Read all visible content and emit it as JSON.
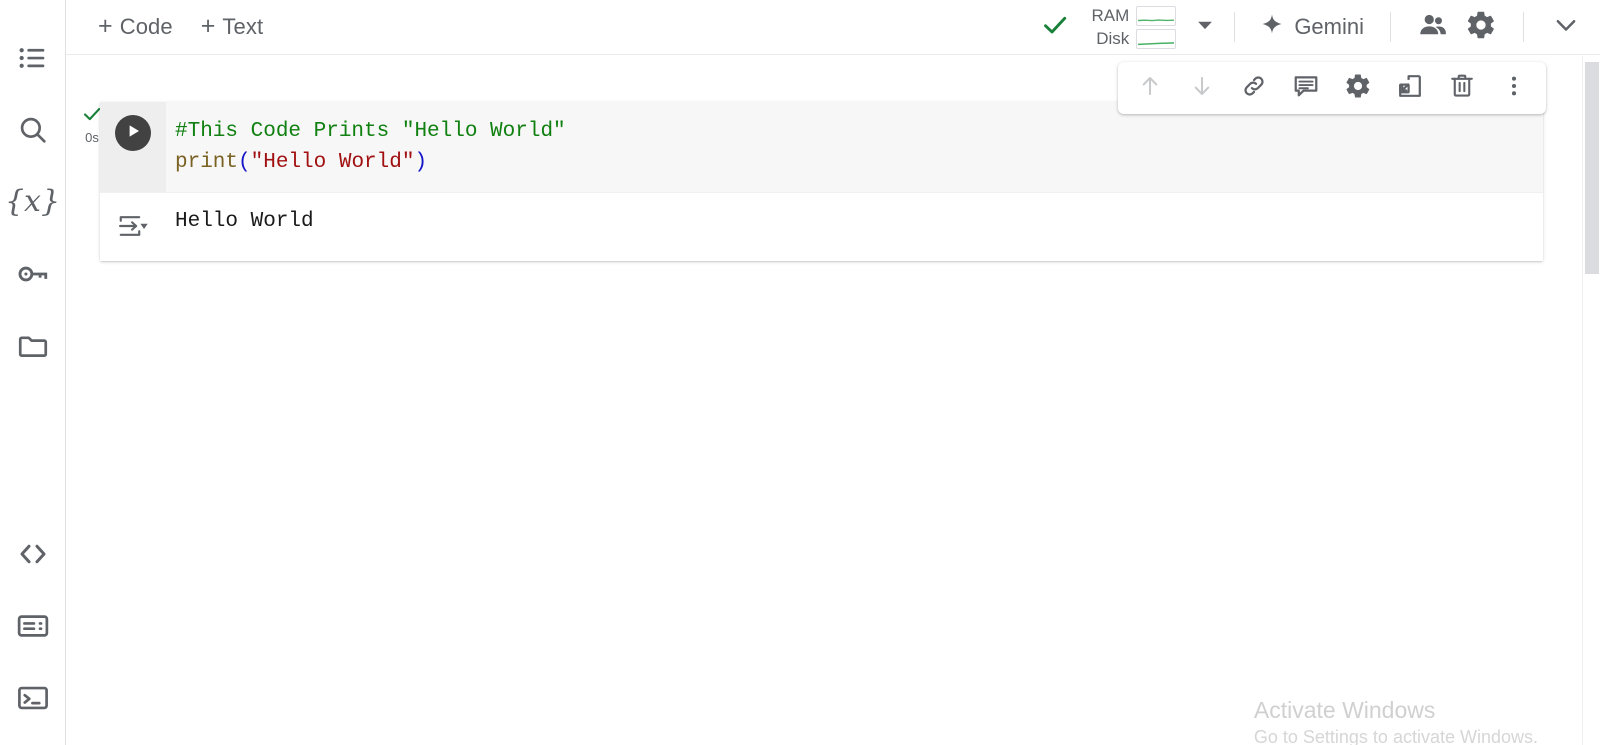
{
  "header": {
    "add_code_label": "Code",
    "add_text_label": "Text",
    "plus_symbol": "+",
    "connect_status_icon": "check-icon",
    "resources": [
      {
        "label": "RAM",
        "icon": "sparkline"
      },
      {
        "label": "Disk",
        "icon": "sparkline"
      }
    ],
    "resource_caret_icon": "caret-down-icon",
    "gemini_label": "Gemini",
    "gemini_icon": "sparkle-icon",
    "share_icon": "people-icon",
    "settings_icon": "gear-icon",
    "collapse_icon": "chevron-down-icon"
  },
  "sidebar": {
    "top_items": [
      {
        "name": "table-of-contents",
        "icon": "list-icon"
      },
      {
        "name": "find-and-replace",
        "icon": "search-icon"
      },
      {
        "name": "variables",
        "icon": "variables-icon",
        "glyph": "{x}"
      },
      {
        "name": "secrets",
        "icon": "key-icon"
      },
      {
        "name": "files",
        "icon": "folder-icon"
      }
    ],
    "bottom_items": [
      {
        "name": "code-snippets",
        "icon": "code-brackets-icon"
      },
      {
        "name": "command-palette",
        "icon": "command-palette-icon"
      },
      {
        "name": "terminal",
        "icon": "terminal-icon"
      }
    ]
  },
  "cell": {
    "execution_status_icon": "check-icon",
    "execution_time": "0s",
    "run_button_icon": "play-icon",
    "code_lines": [
      {
        "tokens": [
          {
            "text": "#This Code Prints \"Hello World\"",
            "type": "comment"
          }
        ]
      },
      {
        "tokens": [
          {
            "text": "print",
            "type": "fn"
          },
          {
            "text": "(",
            "type": "paren"
          },
          {
            "text": "\"Hello World\"",
            "type": "string"
          },
          {
            "text": ")",
            "type": "paren"
          }
        ]
      }
    ],
    "output_icon": "show-output-icon",
    "output_text": "Hello World"
  },
  "cell_toolbar": {
    "buttons": [
      {
        "name": "move-cell-up-button",
        "icon": "arrow-up-icon",
        "disabled": true
      },
      {
        "name": "move-cell-down-button",
        "icon": "arrow-down-icon",
        "disabled": true
      },
      {
        "name": "copy-cell-link-button",
        "icon": "link-icon",
        "disabled": false
      },
      {
        "name": "add-comment-button",
        "icon": "comment-icon",
        "disabled": false
      },
      {
        "name": "cell-settings-button",
        "icon": "gear-icon",
        "disabled": false
      },
      {
        "name": "mirror-cell-in-tab-button",
        "icon": "mirror-cell-icon",
        "disabled": false
      },
      {
        "name": "delete-cell-button",
        "icon": "trash-icon",
        "disabled": false
      },
      {
        "name": "more-cell-actions-button",
        "icon": "more-vert-icon",
        "disabled": false
      }
    ]
  },
  "watermark": {
    "title": "Activate Windows",
    "subtitle": "Go to Settings to activate Windows."
  },
  "colors": {
    "accent_green": "#188038",
    "code_comment": "#108010",
    "code_function": "#7a6223",
    "code_paren": "#1414c8",
    "code_string": "#a11111",
    "icon_gray": "#5f6368",
    "cell_code_bg": "#f7f7f7",
    "run_gutter_bg": "#eeeeee"
  }
}
